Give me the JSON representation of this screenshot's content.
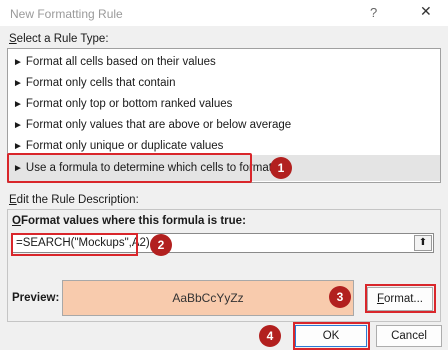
{
  "window": {
    "title": "New Formatting Rule",
    "help_glyph": "?",
    "close_glyph": "✕"
  },
  "rule_type": {
    "label_prefix": "S",
    "label_rest": "elect a Rule Type:",
    "items": [
      "Format all cells based on their values",
      "Format only cells that contain",
      "Format only top or bottom ranked values",
      "Format only values that are above or below average",
      "Format only unique or duplicate values",
      "Use a formula to determine which cells to format"
    ],
    "selected_index": 5,
    "arrow": "►"
  },
  "description": {
    "label_prefix": "E",
    "label_rest": "dit the Rule Description:",
    "formula_label_prefix": "O",
    "formula_label_rest": "Format values where this formula is true:",
    "formula_value": "=SEARCH(\"Mockups\",A2)",
    "collapse_glyph": "⬆"
  },
  "preview": {
    "label": "Preview:",
    "sample_text": "AaBbCcYyZz",
    "fill_color": "#f8cbad"
  },
  "buttons": {
    "format": "Format...",
    "ok": "OK",
    "cancel": "Cancel"
  },
  "badges": [
    "1",
    "2",
    "3",
    "4"
  ],
  "colors": {
    "highlight": "#d9262b",
    "badge": "#b2201f"
  }
}
